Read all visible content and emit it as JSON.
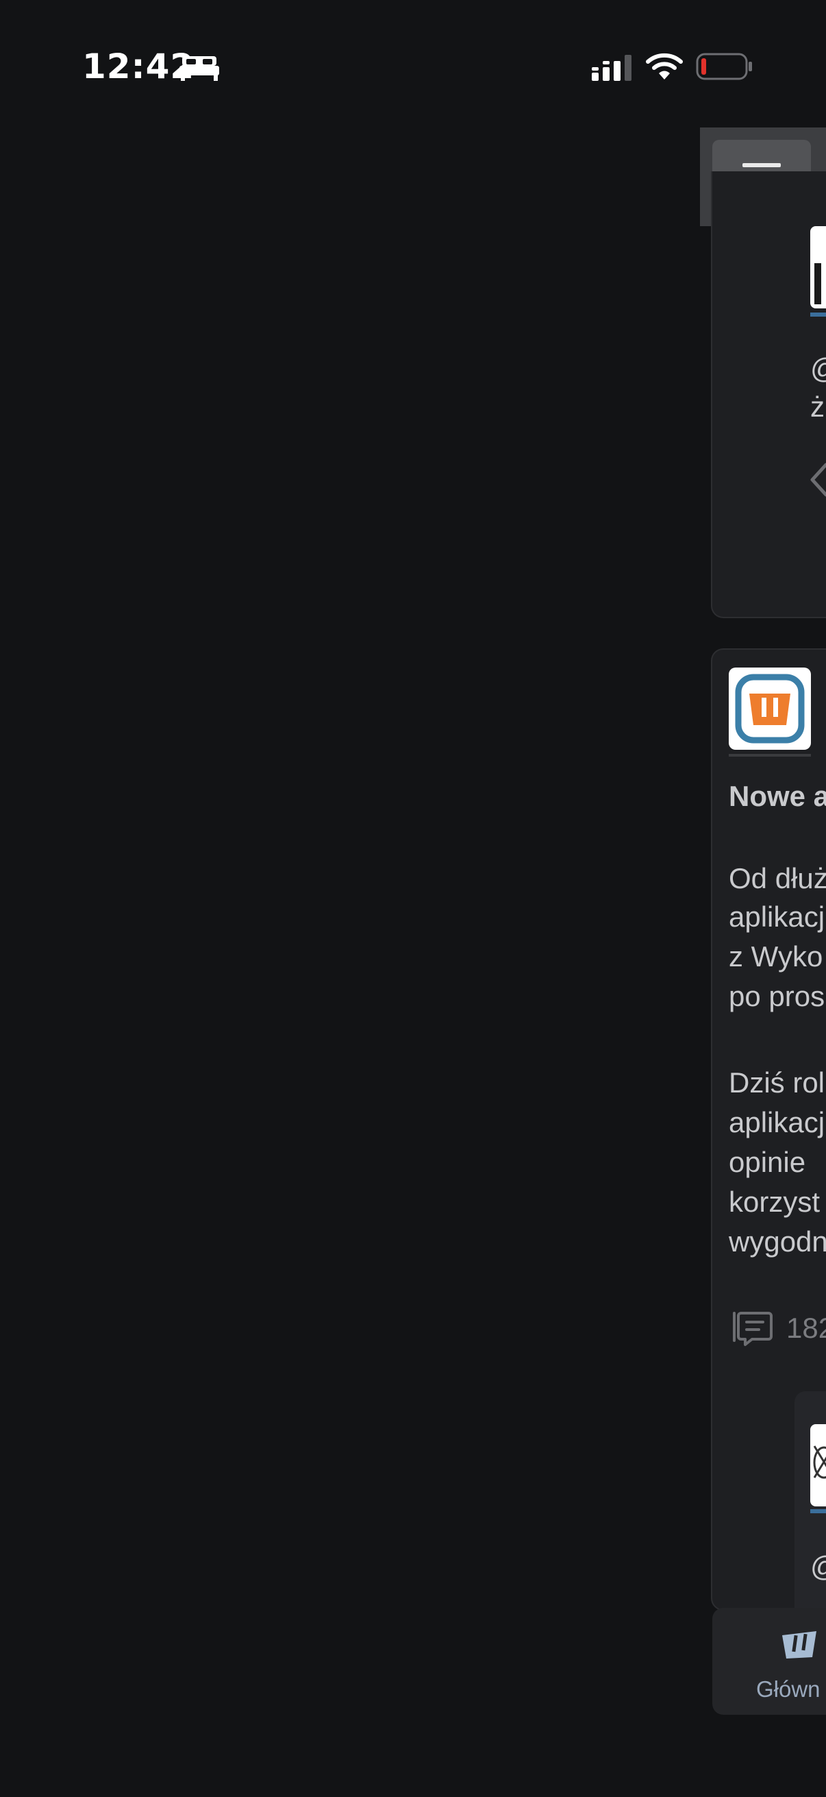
{
  "status_bar": {
    "time": "12:42",
    "icons": [
      "bed-icon",
      "signal-icon",
      "wifi-icon",
      "battery-low-icon"
    ]
  },
  "header": {
    "menu_icon": "hamburger-menu-icon"
  },
  "top_card": {
    "line1": "@",
    "line2": "ż",
    "nav_icon": "chevron-left-icon"
  },
  "main_post": {
    "title": "Nowe a",
    "paragraph1": [
      "Od dłuż",
      "aplikacj",
      "z Wyko",
      "po pros"
    ],
    "paragraph2": [
      "Dziś rol",
      "aplikacj",
      "opinie ",
      "korzyst",
      "wygodn"
    ],
    "comments_count": "182",
    "reply_mention": "@"
  },
  "bottom_nav": {
    "home_label": "Główn"
  },
  "colors": {
    "background": "#121315",
    "card": "#1e1f22",
    "accent_orange": "#ee7d2d",
    "accent_blue": "#3b6f9c"
  }
}
